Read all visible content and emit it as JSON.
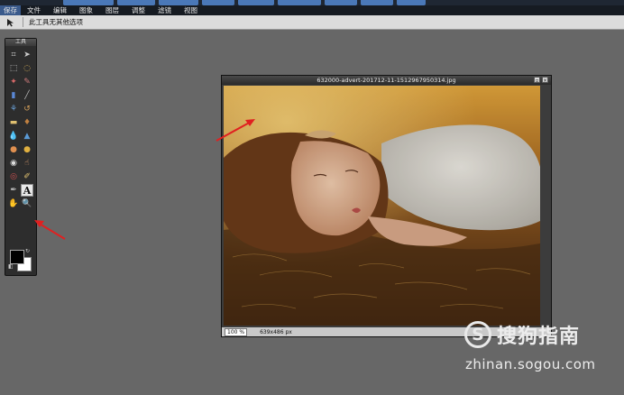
{
  "top_menu": [
    "保存",
    "文件",
    "编辑",
    "图象",
    "图层",
    "调整",
    "滤镜",
    "视图"
  ],
  "options_bar": {
    "tool_icon": "move-arrow-icon",
    "text": "此工具无其他选项"
  },
  "tools_panel": {
    "title": "工具",
    "tools": [
      {
        "name": "crop-icon",
        "glyph": "⌗",
        "color": "#cccccc"
      },
      {
        "name": "move-icon",
        "glyph": "➤",
        "color": "#cccccc"
      },
      {
        "name": "marquee-icon",
        "glyph": "⬚",
        "color": "#cccccc"
      },
      {
        "name": "lasso-icon",
        "glyph": "◌",
        "color": "#d9b25a"
      },
      {
        "name": "magic-wand-icon",
        "glyph": "✦",
        "color": "#d96a6a"
      },
      {
        "name": "pencil-icon",
        "glyph": "✎",
        "color": "#cc7a7a"
      },
      {
        "name": "gradient-icon",
        "glyph": "▮",
        "color": "#5a88d6"
      },
      {
        "name": "brush-icon",
        "glyph": "╱",
        "color": "#bbbbbb"
      },
      {
        "name": "clone-icon",
        "glyph": "⚘",
        "color": "#6aa0d6"
      },
      {
        "name": "color-replace-icon",
        "glyph": "↺",
        "color": "#d6a05a"
      },
      {
        "name": "eraser-icon",
        "glyph": "▬",
        "color": "#e0c070"
      },
      {
        "name": "fill-bucket-icon",
        "glyph": "♦",
        "color": "#c08040"
      },
      {
        "name": "drop-icon",
        "glyph": "💧",
        "color": "#5a9ad6"
      },
      {
        "name": "sharpen-icon",
        "glyph": "▲",
        "color": "#5a9ad6"
      },
      {
        "name": "dodge-icon",
        "glyph": "●",
        "color": "#e09050"
      },
      {
        "name": "burn-icon",
        "glyph": "●",
        "color": "#e0b040"
      },
      {
        "name": "sponge-icon",
        "glyph": "◉",
        "color": "#dddddd"
      },
      {
        "name": "smudge-icon",
        "glyph": "☝",
        "color": "#e0a070"
      },
      {
        "name": "red-eye-icon",
        "glyph": "◎",
        "color": "#cc5050"
      },
      {
        "name": "color-picker-icon",
        "glyph": "✐",
        "color": "#e0c070"
      },
      {
        "name": "pen-icon",
        "glyph": "✒",
        "color": "#bbbbbb"
      },
      {
        "name": "type-tool-icon",
        "glyph": "A",
        "color": "#111111",
        "active": true
      },
      {
        "name": "hand-icon",
        "glyph": "✋",
        "color": "#e0a070"
      },
      {
        "name": "zoom-icon",
        "glyph": "🔍",
        "color": "#cccccc"
      }
    ]
  },
  "colors": {
    "foreground": "#000000",
    "background": "#ffffff"
  },
  "image_window": {
    "title": "632000-advert-201712-11-1512967950314.jpg",
    "zoom": "100",
    "zoom_unit": "%",
    "dimensions": "639x486 px"
  },
  "watermark": {
    "logo": "S",
    "text": "搜狗指南",
    "url": "zhinan.sogou.com"
  }
}
